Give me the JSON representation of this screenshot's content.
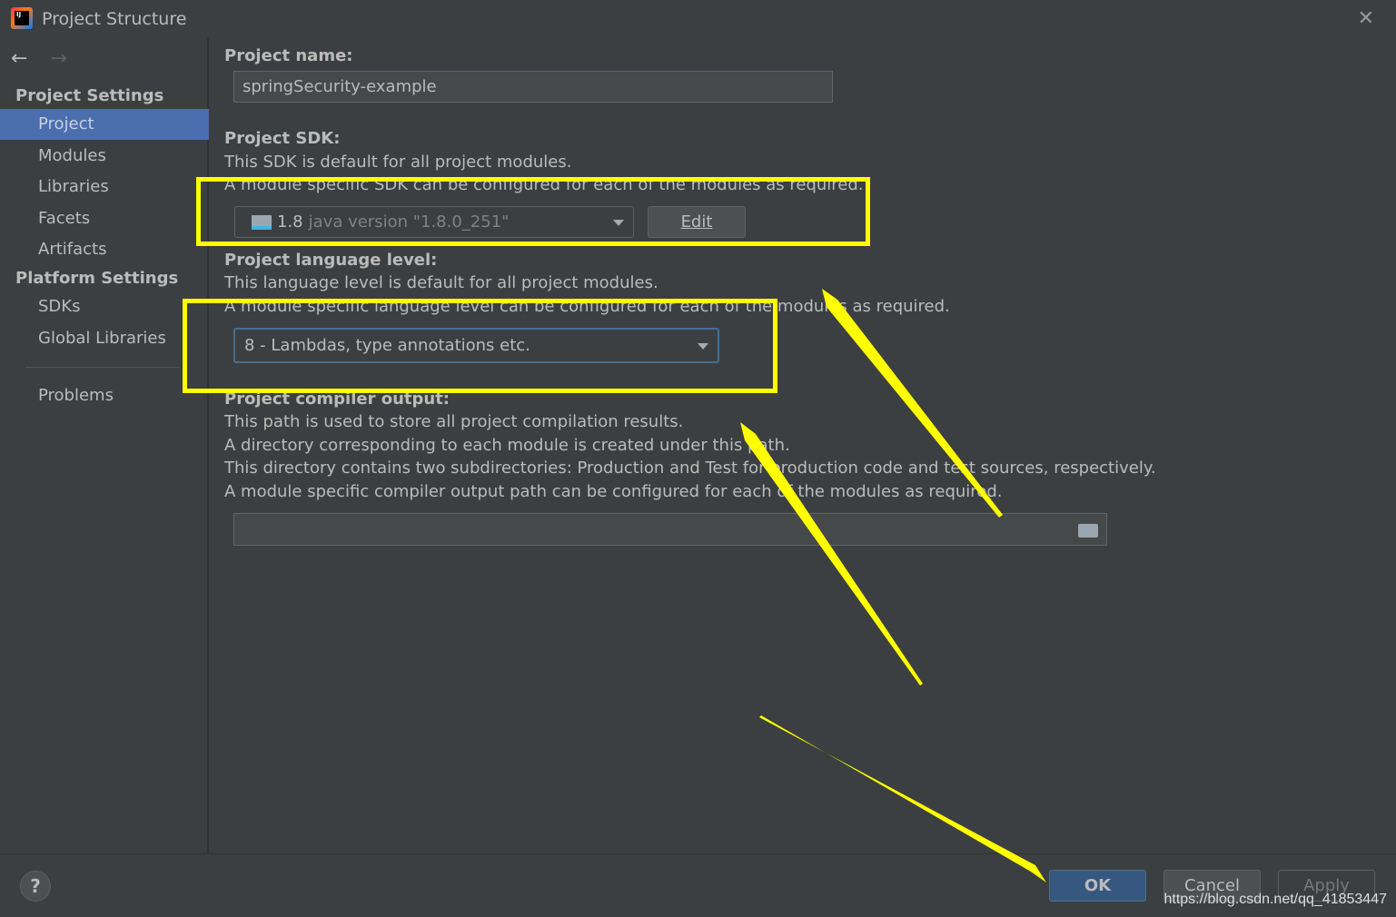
{
  "window": {
    "title": "Project Structure",
    "close_icon": "close-icon"
  },
  "sidebar": {
    "back_icon": "←",
    "forward_icon": "→",
    "project_settings_header": "Project Settings",
    "project_items": [
      {
        "label": "Project",
        "selected": true
      },
      {
        "label": "Modules"
      },
      {
        "label": "Libraries"
      },
      {
        "label": "Facets"
      },
      {
        "label": "Artifacts"
      }
    ],
    "platform_settings_header": "Platform Settings",
    "platform_items": [
      {
        "label": "SDKs"
      },
      {
        "label": "Global Libraries"
      }
    ],
    "problems": "Problems"
  },
  "main": {
    "project_name_label": "Project name:",
    "project_name_value": "springSecurity-example",
    "sdk_label": "Project SDK:",
    "sdk_desc1": "This SDK is default for all project modules.",
    "sdk_desc2": "A module specific SDK can be configured for each of the modules as required.",
    "sdk_version": "1.8",
    "sdk_detail": "java version \"1.8.0_251\"",
    "edit_button": "Edit",
    "lang_label": "Project language level:",
    "lang_desc1": "This language level is default for all project modules.",
    "lang_desc2": "A module specific language level can be configured for each of the modules as required.",
    "lang_value": "8 - Lambdas, type annotations etc.",
    "out_label": "Project compiler output:",
    "out_desc1": "This path is used to store all project compilation results.",
    "out_desc2": "A directory corresponding to each module is created under this path.",
    "out_desc3": "This directory contains two subdirectories: Production and Test for production code and test sources, respectively.",
    "out_desc4": "A module specific compiler output path can be configured for each of the modules as required.",
    "out_value": ""
  },
  "footer": {
    "help": "?",
    "ok": "OK",
    "cancel": "Cancel",
    "apply": "Apply"
  },
  "watermark": "https://blog.csdn.net/qq_41853447",
  "colors": {
    "selection": "#4b6eaf",
    "highlight": "#ffff00",
    "ok_button": "#365880"
  }
}
